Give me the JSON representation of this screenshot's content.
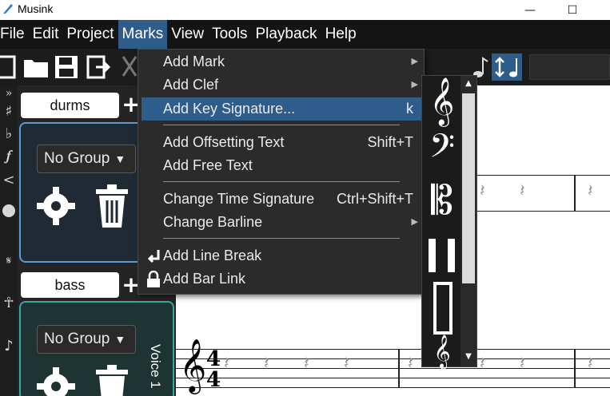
{
  "window": {
    "title": "Musink",
    "controls": {
      "minimize": "—",
      "maximize": "☐",
      "close": "✕"
    }
  },
  "menubar": {
    "items": [
      {
        "label": "File"
      },
      {
        "label": "Edit"
      },
      {
        "label": "Project"
      },
      {
        "label": "Marks"
      },
      {
        "label": "View"
      },
      {
        "label": "Tools"
      },
      {
        "label": "Playback"
      },
      {
        "label": "Help"
      }
    ]
  },
  "marks_menu": {
    "items": [
      {
        "label": "Add Mark",
        "shortcut": "",
        "submenu": true
      },
      {
        "label": "Add Clef",
        "shortcut": "",
        "submenu": true
      },
      {
        "label": "Add Key Signature...",
        "shortcut": "k",
        "submenu": false
      },
      {
        "label": "Add Offsetting Text",
        "shortcut": "Shift+T",
        "submenu": false
      },
      {
        "label": "Add Free Text",
        "shortcut": "",
        "submenu": false
      },
      {
        "label": "Change Time Signature",
        "shortcut": "Ctrl+Shift+T",
        "submenu": false
      },
      {
        "label": "Change Barline",
        "shortcut": "",
        "submenu": true
      },
      {
        "label": "Add Line Break",
        "shortcut": "",
        "submenu": false,
        "icon": "line-break-icon"
      },
      {
        "label": "Add Bar Link",
        "shortcut": "",
        "submenu": false,
        "icon": "lock-icon"
      }
    ],
    "submenu_arrow": "▶"
  },
  "tracks": [
    {
      "name": "durms",
      "group": "No Group"
    },
    {
      "name": "bass",
      "group": "No Group",
      "voice_label": "Voice 1"
    }
  ],
  "plus_symbol": "+",
  "group_caret": "▼",
  "score": {
    "time_signature_top": "4",
    "time_signature_bottom": "4",
    "treble_clef": "𝄞"
  },
  "clef_submenu": {
    "clefs": [
      "𝄞",
      "𝄢",
      "𝄡",
      "𝄥",
      "𝄆"
    ]
  },
  "colors": {
    "menu_highlight": "#2e5d8c",
    "track_card_border": "#5b9bd5",
    "track_card_bass_border": "#3aa6a0",
    "menubar_bg": "#141414"
  }
}
